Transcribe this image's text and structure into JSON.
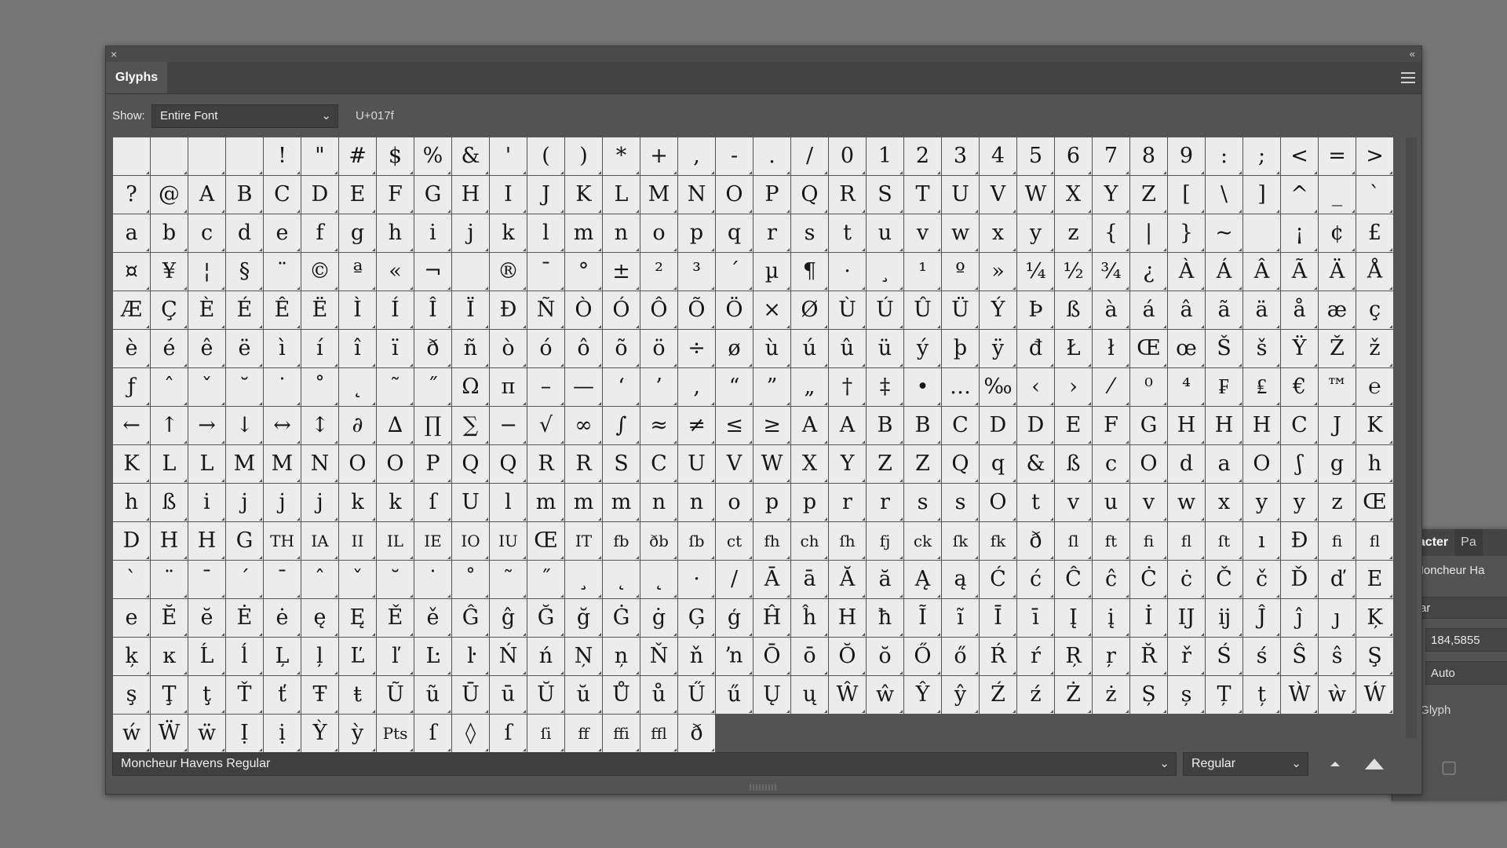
{
  "panel": {
    "title": "Glyphs",
    "show_label": "Show:",
    "show_value": "Entire Font",
    "unicode": "U+017f",
    "font_family": "Moncheur Havens Regular",
    "font_style": "Regular"
  },
  "character_panel": {
    "tab_character": "haracter",
    "tab_other": "Pa",
    "font": "Moncheur Ha",
    "style": "gular",
    "size_value": "184,5855",
    "leading_value": "Auto",
    "snap_label": "p to Glyph"
  },
  "glyph_rows": [
    [
      "",
      " ",
      " ",
      " ",
      "!",
      "\"",
      "#",
      "$",
      "%",
      "&",
      "'",
      "(",
      ")",
      "*",
      "+",
      ",",
      "-",
      ".",
      "/",
      "0",
      "1",
      "2",
      "3",
      "4",
      "5",
      "6",
      "7",
      "8",
      "9",
      ":",
      ";",
      "<",
      "=",
      ">"
    ],
    [
      "?",
      "@",
      "A",
      "B",
      "C",
      "D",
      "E",
      "F",
      "G",
      "H",
      "I",
      "J",
      "K",
      "L",
      "M",
      "N",
      "O",
      "P",
      "Q",
      "R",
      "S",
      "T",
      "U",
      "V",
      "W",
      "X",
      "Y",
      "Z",
      "[",
      "\\",
      "]",
      "^",
      "_",
      "`"
    ],
    [
      "a",
      "b",
      "c",
      "d",
      "e",
      "f",
      "g",
      "h",
      "i",
      "j",
      "k",
      "l",
      "m",
      "n",
      "o",
      "p",
      "q",
      "r",
      "s",
      "t",
      "u",
      "v",
      "w",
      "x",
      "y",
      "z",
      "{",
      "|",
      "}",
      "~",
      " ",
      "¡",
      "¢",
      "£"
    ],
    [
      "¤",
      "¥",
      "¦",
      "§",
      "¨",
      "©",
      "ª",
      "«",
      "¬",
      " ",
      "®",
      "¯",
      "°",
      "±",
      "²",
      "³",
      "´",
      "µ",
      "¶",
      "·",
      "¸",
      "¹",
      "º",
      "»",
      "¼",
      "½",
      "¾",
      "¿",
      "À",
      "Á",
      "Â",
      "Ã",
      "Ä",
      "Å"
    ],
    [
      "Æ",
      "Ç",
      "È",
      "É",
      "Ê",
      "Ë",
      "Ì",
      "Í",
      "Î",
      "Ï",
      "Ð",
      "Ñ",
      "Ò",
      "Ó",
      "Ô",
      "Õ",
      "Ö",
      "×",
      "Ø",
      "Ù",
      "Ú",
      "Û",
      "Ü",
      "Ý",
      "Þ",
      "ß",
      "à",
      "á",
      "â",
      "ã",
      "ä",
      "å",
      "æ",
      "ç"
    ],
    [
      "è",
      "é",
      "ê",
      "ë",
      "ì",
      "í",
      "î",
      "ï",
      "ð",
      "ñ",
      "ò",
      "ó",
      "ô",
      "õ",
      "ö",
      "÷",
      "ø",
      "ù",
      "ú",
      "û",
      "ü",
      "ý",
      "þ",
      "ÿ",
      "đ",
      "Ł",
      "ł",
      "Œ",
      "œ",
      "Š",
      "š",
      "Ÿ",
      "Ž",
      "ž"
    ],
    [
      "ƒ",
      "ˆ",
      "ˇ",
      "˘",
      "˙",
      "˚",
      "˛",
      "˜",
      "˝",
      "Ω",
      "π",
      "–",
      "—",
      "‘",
      "’",
      "‚",
      "“",
      "”",
      "„",
      "†",
      "‡",
      "•",
      "…",
      "‰",
      "‹",
      "›",
      "⁄",
      "⁰",
      "⁴",
      "₣",
      "₤",
      "€",
      "™"
    ],
    [
      "℮",
      "←",
      "↑",
      "→",
      "↓",
      "↔",
      "↕",
      "∂",
      "∆",
      "∏",
      "∑",
      "−",
      "√",
      "∞",
      "∫",
      "≈",
      "≠",
      "≤",
      "≥",
      "A",
      "A",
      "B",
      "B",
      "C",
      "D",
      "D",
      "E",
      "F",
      "G",
      "H",
      "H",
      "H",
      "C",
      "J"
    ],
    [
      "K",
      "K",
      "L",
      "L",
      "M",
      "M",
      "N",
      "O",
      "O",
      "P",
      "Q",
      "Q",
      "R",
      "R",
      "S",
      "C",
      "U",
      "V",
      "W",
      "X",
      "Y",
      "Z",
      "Z",
      "Q",
      "q",
      "&",
      "ß",
      "c",
      "O",
      "d",
      "a",
      "O",
      "ʃ",
      "g"
    ],
    [
      "h",
      "h",
      "ß",
      "i",
      "j",
      "j",
      "j",
      "k",
      "k",
      "ſ",
      "U",
      "l",
      "m",
      "m",
      "m",
      "n",
      "n",
      "o",
      "p",
      "p",
      "r",
      "r",
      "s",
      "s",
      "O",
      "t",
      "v",
      "u",
      "v",
      "w",
      "x",
      "y",
      "y",
      "z"
    ],
    [
      "Œ",
      "D",
      "H",
      "H",
      "G",
      "TH",
      "IA",
      "II",
      "IL",
      "IE",
      "IO",
      "IU",
      "Œ",
      "IT",
      "fb",
      "ðb",
      "ſb",
      "ct",
      "fh",
      "ch",
      "ſh",
      "fj",
      "ck",
      "ſk",
      "fk",
      "ð",
      "ſl",
      "ft",
      "fi",
      "fl",
      "ſt",
      "ı",
      "Đ",
      "fi"
    ],
    [
      "fl",
      "`",
      "¨",
      "¯",
      "´",
      "¯",
      "ˆ",
      "ˇ",
      "˘",
      "˙",
      "˚",
      "˜",
      "˝",
      "¸",
      "˛",
      "˛",
      "·",
      "/",
      "Ā",
      "ā",
      "Ă",
      "ă",
      "Ą",
      "ą",
      "Ć",
      "ć",
      "Ĉ",
      "ĉ",
      "Ċ",
      "ċ",
      "Č",
      "č",
      "Ď",
      "ď"
    ],
    [
      "E",
      "e",
      "Ĕ",
      "ĕ",
      "Ė",
      "ė",
      "ę",
      "Ę",
      "Ě",
      "ě",
      "Ĝ",
      "ĝ",
      "Ğ",
      "ğ",
      "Ġ",
      "ġ",
      "Ģ",
      "ģ",
      "Ĥ",
      "ĥ",
      "H",
      "ħ",
      "Ĩ",
      "ĩ",
      "Ī",
      "ī",
      "Į",
      "į",
      "İ",
      "Ĳ",
      "ĳ",
      "Ĵ",
      "ĵ",
      "ȷ"
    ],
    [
      "Ķ",
      "ķ",
      "ĸ",
      "Ĺ",
      "ĺ",
      "Ļ",
      "ļ",
      "Ľ",
      "ľ",
      "Ŀ",
      "ŀ",
      "Ń",
      "ń",
      "Ņ",
      "ņ",
      "Ň",
      "ň",
      "ŉ",
      "Ō",
      "ō",
      "Ŏ",
      "ŏ",
      "Ő",
      "ő",
      "Ŕ",
      "ŕ",
      "Ŗ",
      "ŗ",
      "Ř",
      "ř",
      "Ś",
      "ś",
      "Ŝ",
      "ŝ"
    ],
    [
      "Ş",
      "ş",
      "Ţ",
      "ţ",
      "Ť",
      "ť",
      "Ŧ",
      "ŧ",
      "Ũ",
      "ũ",
      "Ū",
      "ū",
      "Ŭ",
      "ŭ",
      "Ů",
      "ů",
      "Ű",
      "ű",
      "Ų",
      "ų",
      "Ŵ",
      "ŵ",
      "Ŷ",
      "ŷ",
      "Ź",
      "ź",
      "Ż",
      "ż",
      "Ș",
      "ș",
      "Ț",
      "ț",
      "Ẁ",
      "ẁ"
    ],
    [
      "Ẃ",
      "ẃ",
      "Ẅ",
      "ẅ",
      "Ị",
      "ị",
      "Ỳ",
      "ỳ",
      "Pts",
      "ſ",
      "◊",
      "ſ",
      "ſi",
      "ff",
      "ffi",
      "ffl",
      "ð"
    ]
  ]
}
